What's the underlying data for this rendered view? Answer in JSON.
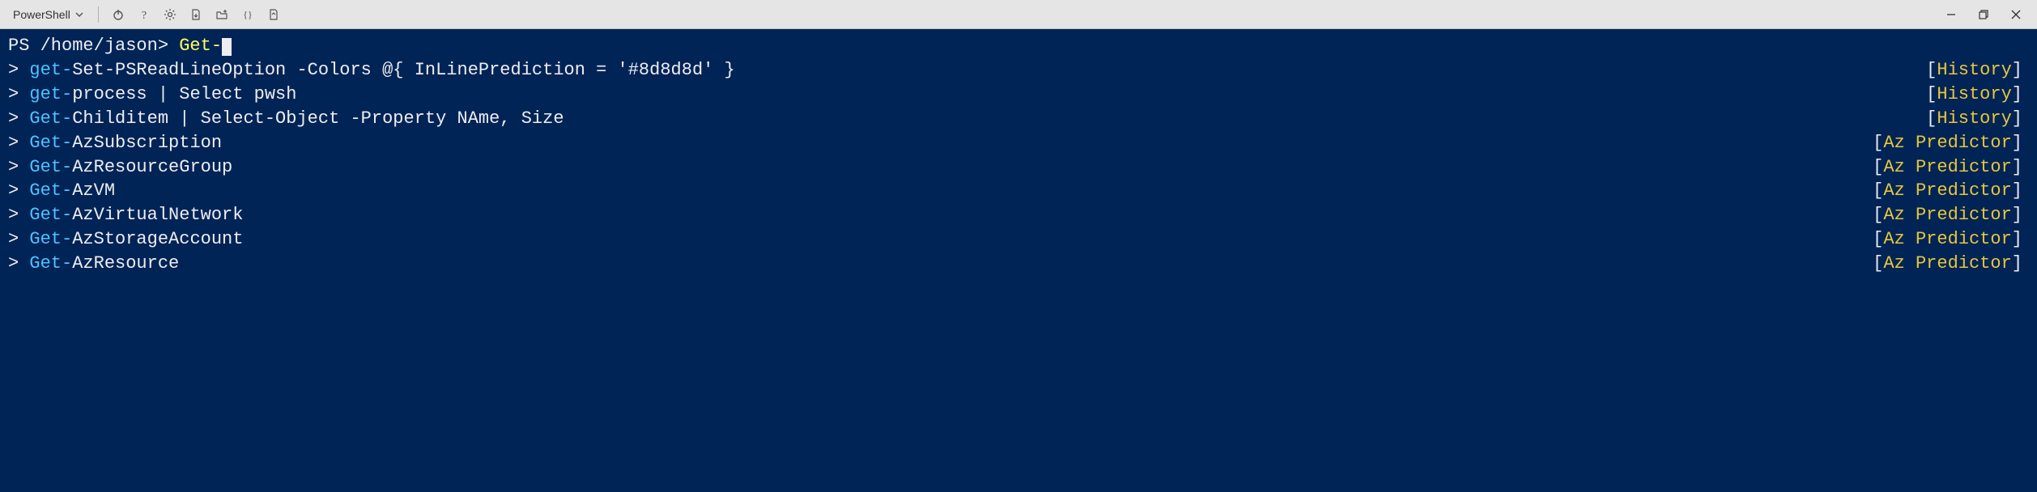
{
  "titlebar": {
    "shell_name": "PowerShell"
  },
  "prompt": {
    "prefix": "PS /home/jason> ",
    "input": "Get-"
  },
  "suggestions": [
    {
      "chevron": "> ",
      "prefix": "get-",
      "rest": "Set-PSReadLineOption -Colors @{ InLinePrediction = '#8d8d8d' }",
      "source": "History"
    },
    {
      "chevron": "> ",
      "prefix": "get-",
      "rest": "process | Select pwsh",
      "source": "History"
    },
    {
      "chevron": "> ",
      "prefix": "Get-",
      "rest": "Childitem | Select-Object -Property NAme, Size",
      "source": "History"
    },
    {
      "chevron": "> ",
      "prefix": "Get-",
      "rest": "AzSubscription",
      "source": "Az Predictor"
    },
    {
      "chevron": "> ",
      "prefix": "Get-",
      "rest": "AzResourceGroup",
      "source": "Az Predictor"
    },
    {
      "chevron": "> ",
      "prefix": "Get-",
      "rest": "AzVM",
      "source": "Az Predictor"
    },
    {
      "chevron": "> ",
      "prefix": "Get-",
      "rest": "AzVirtualNetwork",
      "source": "Az Predictor"
    },
    {
      "chevron": "> ",
      "prefix": "Get-",
      "rest": "AzStorageAccount",
      "source": "Az Predictor"
    },
    {
      "chevron": "> ",
      "prefix": "Get-",
      "rest": "AzResource",
      "source": "Az Predictor"
    }
  ]
}
